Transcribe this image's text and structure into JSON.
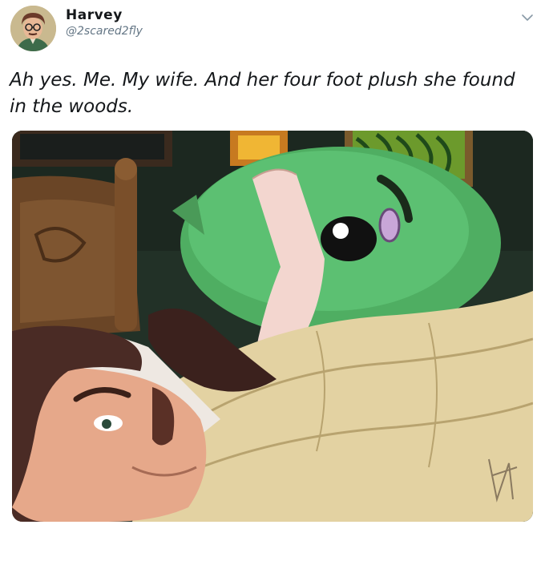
{
  "tweet": {
    "author_name": "Harvey",
    "author_handle": "@2scared2fly",
    "text": "Ah yes. Me. My wife. And her four foot plush she found in the woods."
  },
  "icons": {
    "menu": "chevron-down-icon",
    "avatar": "profile-avatar"
  },
  "colors": {
    "text": "#14171a",
    "secondary": "#657786",
    "plush": "#5cc072",
    "blanket": "#e9d9ad",
    "hair": "#4a2b25"
  }
}
